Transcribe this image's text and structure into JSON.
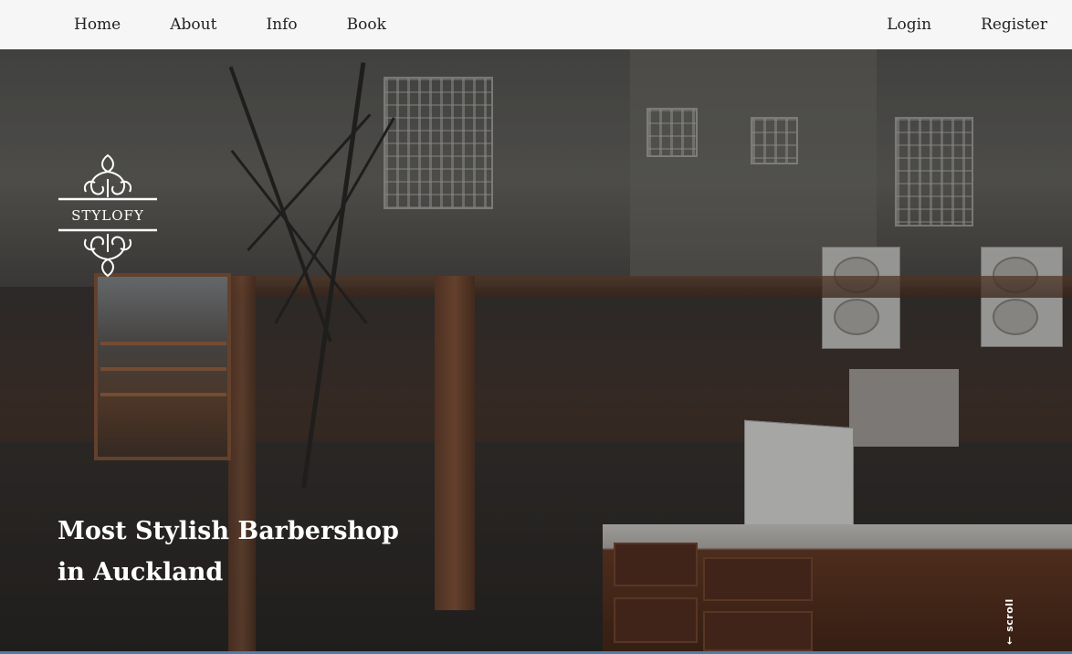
{
  "nav": {
    "left_items": [
      {
        "label": "Home"
      },
      {
        "label": "About"
      },
      {
        "label": "Info"
      },
      {
        "label": "Book"
      }
    ],
    "right_items": [
      {
        "label": "Login"
      },
      {
        "label": "Register"
      }
    ]
  },
  "logo": {
    "text": "STYLOFY",
    "icon": "ornamental-scroll-icon"
  },
  "hero": {
    "title_line1": "Most Stylish Barbershop",
    "title_line2": "in Auckland",
    "scroll_label": "← scroll"
  },
  "colors": {
    "navbar_bg": "#f6f6f6",
    "nav_text": "#222222",
    "hero_text": "#ffffff",
    "accent_line": "#4a7fa8"
  }
}
